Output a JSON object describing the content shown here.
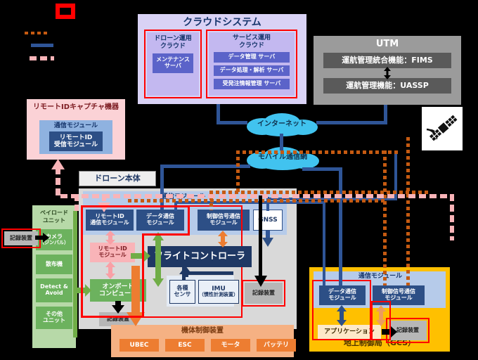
{
  "legend": {
    "marker_label": "",
    "items": [
      {
        "style": "orange-dotted",
        "label": ""
      },
      {
        "style": "blue-solid",
        "label": ""
      },
      {
        "style": "pink-dashed",
        "label": ""
      }
    ]
  },
  "cloud_system": {
    "title": "クラウドシステム",
    "drone_ops": {
      "title": "ドローン運用\nクラウド",
      "title_line1": "ドローン運用",
      "title_line2": "クラウド",
      "servers": [
        "メンテナンス\nサーバ"
      ],
      "server1_line1": "メンテナンス",
      "server1_line2": "サーバ"
    },
    "service_ops": {
      "title_line1": "サービス運用",
      "title_line2": "クラウド",
      "servers": [
        "データ管理 サーバ",
        "データ処理・解析 サーバ",
        "受発注情報管理 サーバ"
      ]
    }
  },
  "utm": {
    "title": "UTM",
    "functions": [
      "運航管理統合機能：FIMS",
      "運航管理機能：UASSP"
    ]
  },
  "networks": {
    "internet": "インターネット",
    "mobile": "モバイル通信網"
  },
  "satellite": {
    "icon": "satellite-icon"
  },
  "remote_id_capture": {
    "title": "リモートIDキャプチャ機器",
    "comm_module": "通信モジュール",
    "receiver_line1": "リモートID",
    "receiver_line2": "受信モジュール"
  },
  "drone": {
    "title": "ドローン本体",
    "comm_module_label": "通信モジュール",
    "comm_modules": [
      {
        "line1": "リモートID",
        "line2": "通信モジュール"
      },
      {
        "line1": "データ通信",
        "line2": "モジュール"
      },
      {
        "line1": "制御信号通信",
        "line2": "モジュール"
      }
    ],
    "gnss": "GNSS",
    "remote_id_module_line1": "リモートID",
    "remote_id_module_line2": "モジュール",
    "onboard_computer_line1": "オンボード",
    "onboard_computer_line2": "コンピュータ",
    "flight_controller": "フライトコントローラ",
    "recorder": "記録装置",
    "sensors_line1": "各種",
    "sensors_line2": "センサ",
    "imu_line1": "IMU",
    "imu_line2": "（慣性計測装置）",
    "airframe_control": {
      "title": "機体制御装置",
      "parts": [
        "UBEC",
        "ESC",
        "モータ",
        "バッテリ"
      ]
    }
  },
  "payload": {
    "title_line1": "ペイロード",
    "title_line2": "ユニット",
    "items": [
      {
        "line1": "カメラ",
        "line2": "（ジンバル）"
      },
      {
        "line1": "散布機",
        "line2": ""
      },
      {
        "line1": "Detect &",
        "line2": "Avoid"
      },
      {
        "line1": "その他",
        "line2": "ユニット"
      }
    ],
    "recorder": "記録装置"
  },
  "gcs": {
    "title": "地上制御局（GCS）",
    "comm_module_label": "通信モジュール",
    "modules": [
      {
        "line1": "データ通信",
        "line2": "モジュール"
      },
      {
        "line1": "制御信号通信",
        "line2": "モジュール"
      }
    ],
    "application": "アプリケーション",
    "recorder": "記録装置"
  },
  "colors": {
    "red_border": "#ff0000",
    "blue_line": "#2f5597",
    "orange_line": "#c55a11",
    "pink_line": "#f9b4b8",
    "cloud": "#41c3ef",
    "gcs_yellow": "#ffc000",
    "payload_green": "#b7d9a8",
    "navy": "#1f3864"
  }
}
